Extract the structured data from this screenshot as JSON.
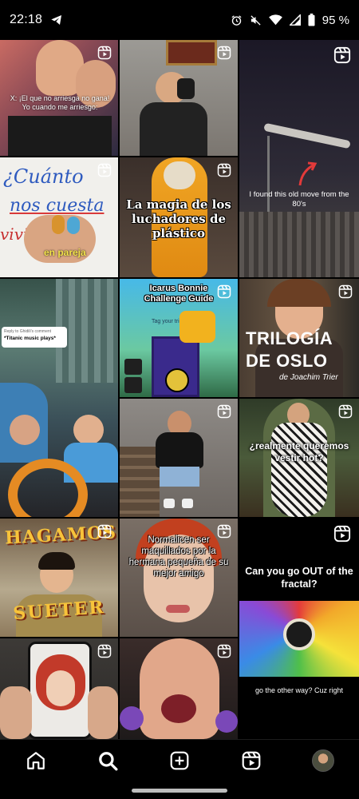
{
  "status_bar": {
    "time": "22:18",
    "battery": "95 %",
    "icons": [
      "telegram-icon",
      "alarm-icon",
      "mute-icon",
      "wifi-icon",
      "signal-icon",
      "battery-icon"
    ]
  },
  "grid": {
    "badge_icon": "reels-icon",
    "tiles": [
      {
        "captions": [
          "X: ¡El que no arriesga no gana!",
          "Yo cuando me arriesgo:"
        ]
      },
      {
        "captions": []
      },
      {
        "captions": [
          "I found this old move from the 80's"
        ]
      },
      {
        "captions": [
          "¿Cuánto",
          "nos cuesta",
          "vivir",
          "en pareja"
        ]
      },
      {
        "captions": [
          "La magia de los luchadores de plástico"
        ]
      },
      {
        "captions": [
          "Reply to Ghidili's comment",
          "*Titanic music plays*"
        ]
      },
      {
        "captions": [
          "Icarus Bonnie Challenge Guide",
          "Tag your trio"
        ]
      },
      {
        "captions": [
          "TRILOGÍA",
          "DE OSLO",
          "de Joachim Trier"
        ]
      },
      {
        "captions": []
      },
      {
        "captions": [
          "¿realmente queremos vestir hot?"
        ]
      },
      {
        "captions": [
          "HAGAMOS",
          "SUETER"
        ]
      },
      {
        "captions": [
          "Normalicen ser maquillados por la hermana pequeña de su mejor amigo"
        ]
      },
      {
        "captions": [
          "Can you go OUT of the fractal?",
          "go the other way? Cuz right"
        ]
      },
      {
        "captions": []
      },
      {
        "captions": []
      }
    ]
  },
  "nav": {
    "items": [
      "home-icon",
      "search-icon",
      "create-icon",
      "reels-icon",
      "profile-avatar"
    ]
  },
  "colors": {
    "background": "#000000",
    "accent": "#ffffff"
  }
}
